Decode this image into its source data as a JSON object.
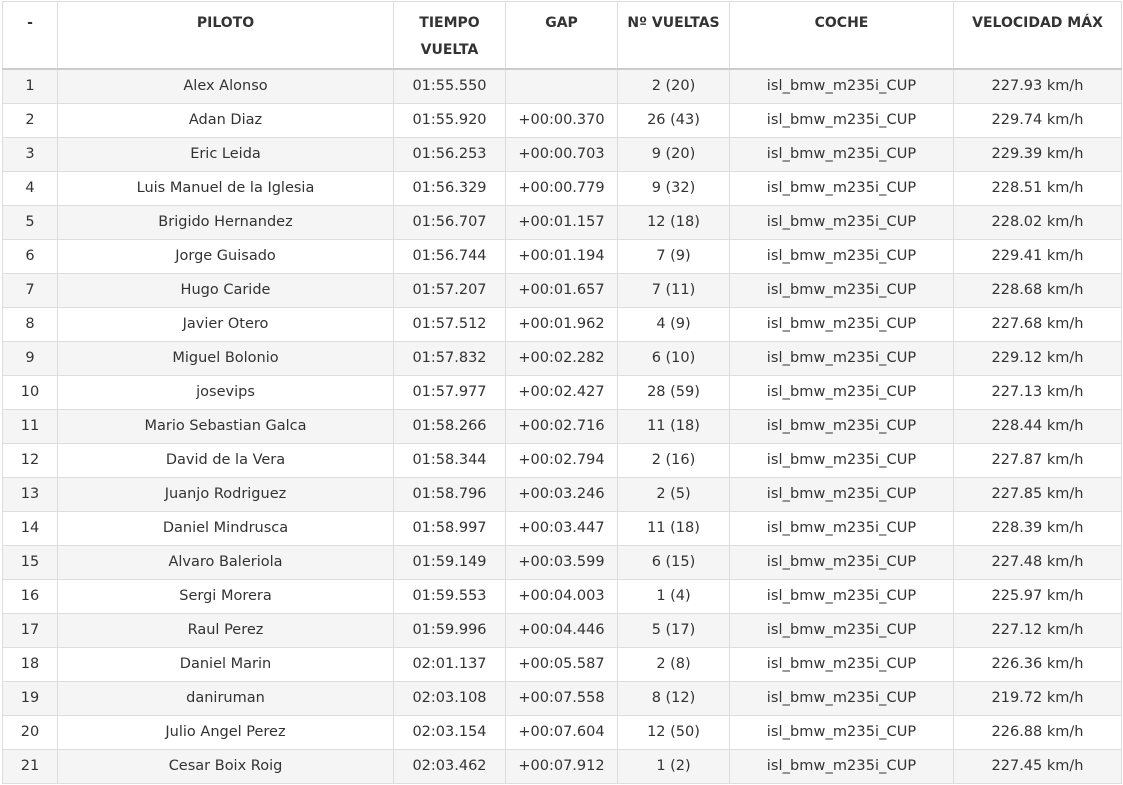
{
  "table": {
    "headers": {
      "pos": "-",
      "driver": "PILOTO",
      "lap_time": "TIEMPO VUELTA",
      "gap": "GAP",
      "laps": "Nº VUELTAS",
      "car": "COCHE",
      "top_speed": "VELOCIDAD MÁX"
    },
    "rows": [
      {
        "pos": "1",
        "driver": "Alex Alonso",
        "lap_time": "01:55.550",
        "gap": "",
        "laps": "2 (20)",
        "car": "isl_bmw_m235i_CUP",
        "top_speed": "227.93 km/h"
      },
      {
        "pos": "2",
        "driver": "Adan Diaz",
        "lap_time": "01:55.920",
        "gap": "+00:00.370",
        "laps": "26 (43)",
        "car": "isl_bmw_m235i_CUP",
        "top_speed": "229.74 km/h"
      },
      {
        "pos": "3",
        "driver": "Eric Leida",
        "lap_time": "01:56.253",
        "gap": "+00:00.703",
        "laps": "9 (20)",
        "car": "isl_bmw_m235i_CUP",
        "top_speed": "229.39 km/h"
      },
      {
        "pos": "4",
        "driver": "Luis Manuel de la Iglesia",
        "lap_time": "01:56.329",
        "gap": "+00:00.779",
        "laps": "9 (32)",
        "car": "isl_bmw_m235i_CUP",
        "top_speed": "228.51 km/h"
      },
      {
        "pos": "5",
        "driver": "Brigido Hernandez",
        "lap_time": "01:56.707",
        "gap": "+00:01.157",
        "laps": "12 (18)",
        "car": "isl_bmw_m235i_CUP",
        "top_speed": "228.02 km/h"
      },
      {
        "pos": "6",
        "driver": "Jorge Guisado",
        "lap_time": "01:56.744",
        "gap": "+00:01.194",
        "laps": "7 (9)",
        "car": "isl_bmw_m235i_CUP",
        "top_speed": "229.41 km/h"
      },
      {
        "pos": "7",
        "driver": "Hugo Caride",
        "lap_time": "01:57.207",
        "gap": "+00:01.657",
        "laps": "7 (11)",
        "car": "isl_bmw_m235i_CUP",
        "top_speed": "228.68 km/h"
      },
      {
        "pos": "8",
        "driver": "Javier Otero",
        "lap_time": "01:57.512",
        "gap": "+00:01.962",
        "laps": "4 (9)",
        "car": "isl_bmw_m235i_CUP",
        "top_speed": "227.68 km/h"
      },
      {
        "pos": "9",
        "driver": "Miguel Bolonio",
        "lap_time": "01:57.832",
        "gap": "+00:02.282",
        "laps": "6 (10)",
        "car": "isl_bmw_m235i_CUP",
        "top_speed": "229.12 km/h"
      },
      {
        "pos": "10",
        "driver": "josevips",
        "lap_time": "01:57.977",
        "gap": "+00:02.427",
        "laps": "28 (59)",
        "car": "isl_bmw_m235i_CUP",
        "top_speed": "227.13 km/h"
      },
      {
        "pos": "11",
        "driver": "Mario Sebastian Galca",
        "lap_time": "01:58.266",
        "gap": "+00:02.716",
        "laps": "11 (18)",
        "car": "isl_bmw_m235i_CUP",
        "top_speed": "228.44 km/h"
      },
      {
        "pos": "12",
        "driver": "David de la Vera",
        "lap_time": "01:58.344",
        "gap": "+00:02.794",
        "laps": "2 (16)",
        "car": "isl_bmw_m235i_CUP",
        "top_speed": "227.87 km/h"
      },
      {
        "pos": "13",
        "driver": "Juanjo Rodriguez",
        "lap_time": "01:58.796",
        "gap": "+00:03.246",
        "laps": "2 (5)",
        "car": "isl_bmw_m235i_CUP",
        "top_speed": "227.85 km/h"
      },
      {
        "pos": "14",
        "driver": "Daniel Mindrusca",
        "lap_time": "01:58.997",
        "gap": "+00:03.447",
        "laps": "11 (18)",
        "car": "isl_bmw_m235i_CUP",
        "top_speed": "228.39 km/h"
      },
      {
        "pos": "15",
        "driver": "Alvaro Baleriola",
        "lap_time": "01:59.149",
        "gap": "+00:03.599",
        "laps": "6 (15)",
        "car": "isl_bmw_m235i_CUP",
        "top_speed": "227.48 km/h"
      },
      {
        "pos": "16",
        "driver": "Sergi Morera",
        "lap_time": "01:59.553",
        "gap": "+00:04.003",
        "laps": "1 (4)",
        "car": "isl_bmw_m235i_CUP",
        "top_speed": "225.97 km/h"
      },
      {
        "pos": "17",
        "driver": "Raul Perez",
        "lap_time": "01:59.996",
        "gap": "+00:04.446",
        "laps": "5 (17)",
        "car": "isl_bmw_m235i_CUP",
        "top_speed": "227.12 km/h"
      },
      {
        "pos": "18",
        "driver": "Daniel Marin",
        "lap_time": "02:01.137",
        "gap": "+00:05.587",
        "laps": "2 (8)",
        "car": "isl_bmw_m235i_CUP",
        "top_speed": "226.36 km/h"
      },
      {
        "pos": "19",
        "driver": "daniruman",
        "lap_time": "02:03.108",
        "gap": "+00:07.558",
        "laps": "8 (12)",
        "car": "isl_bmw_m235i_CUP",
        "top_speed": "219.72 km/h"
      },
      {
        "pos": "20",
        "driver": "Julio Angel Perez",
        "lap_time": "02:03.154",
        "gap": "+00:07.604",
        "laps": "12 (50)",
        "car": "isl_bmw_m235i_CUP",
        "top_speed": "226.88 km/h"
      },
      {
        "pos": "21",
        "driver": "Cesar Boix Roig",
        "lap_time": "02:03.462",
        "gap": "+00:07.912",
        "laps": "1 (2)",
        "car": "isl_bmw_m235i_CUP",
        "top_speed": "227.45 km/h"
      }
    ]
  }
}
